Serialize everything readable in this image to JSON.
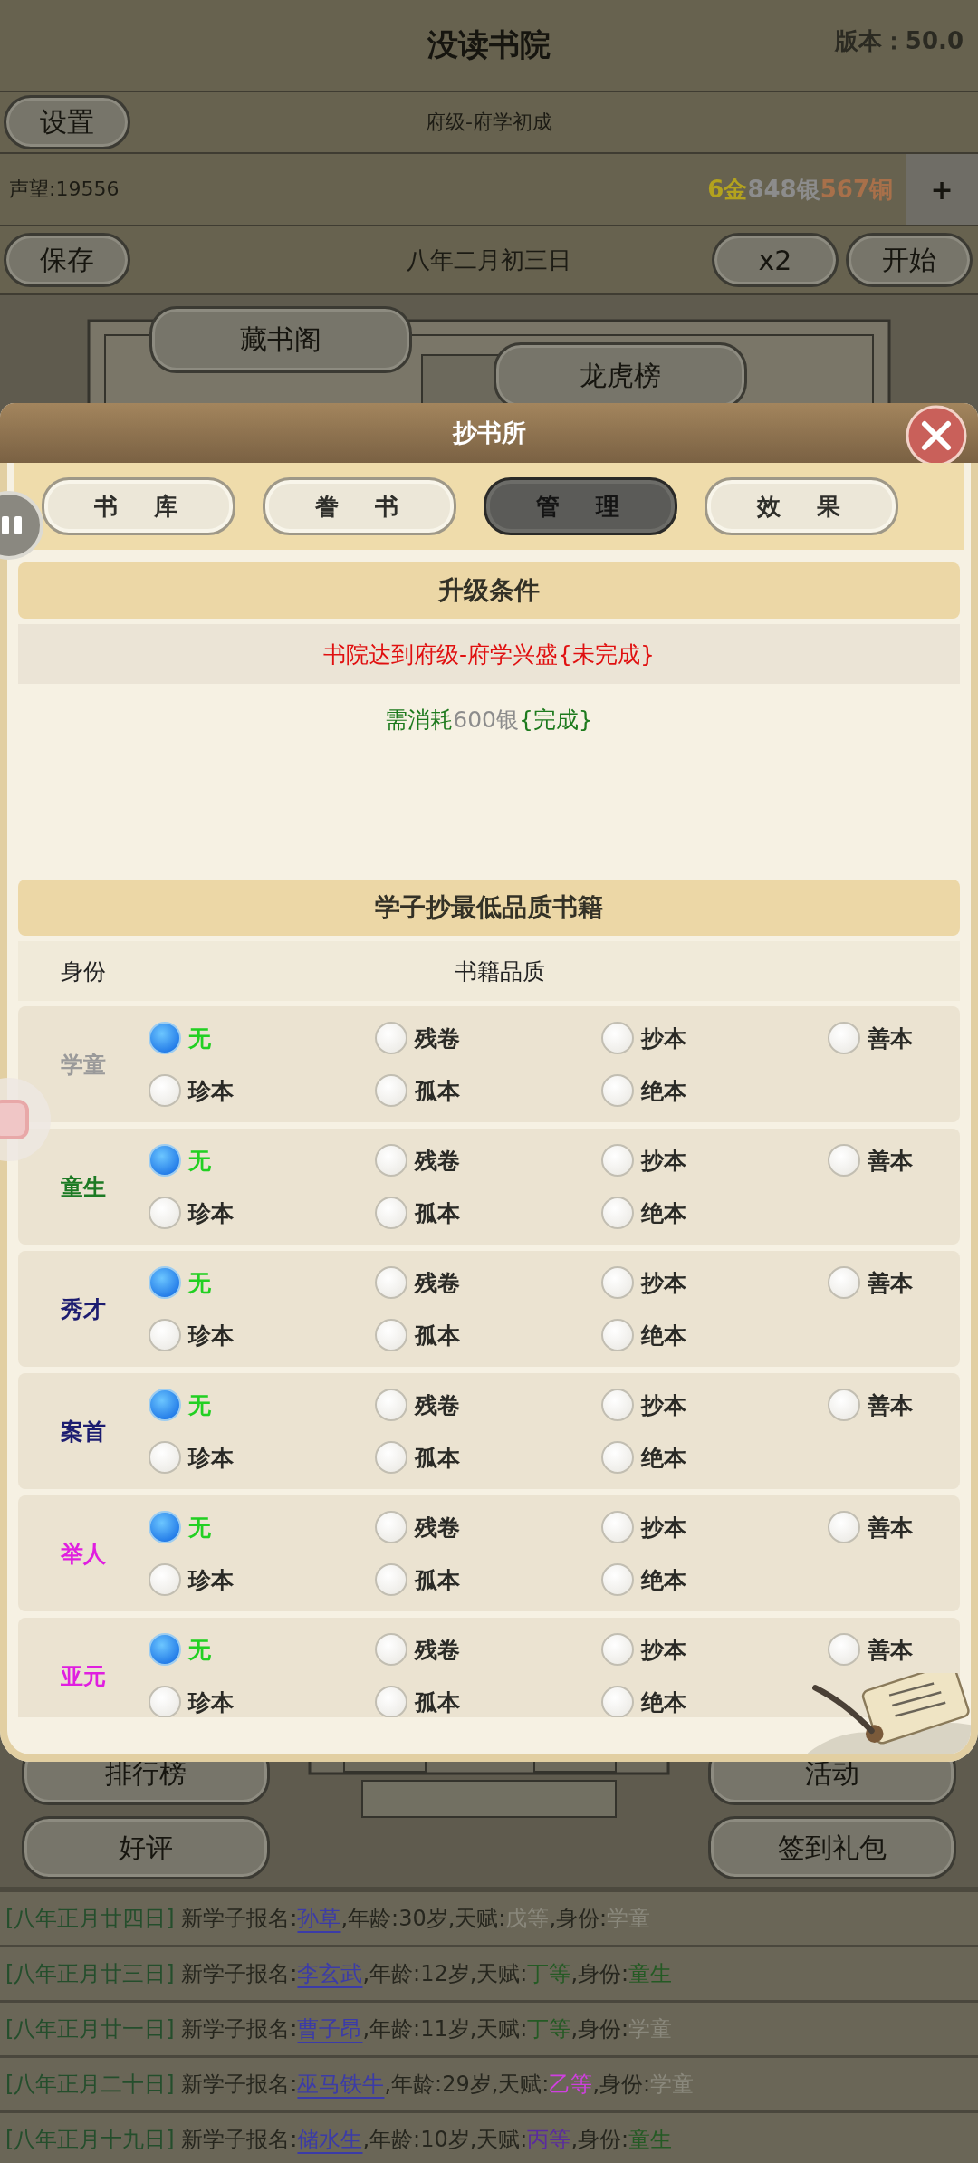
{
  "app_header": {
    "title": "没读书院",
    "version": "版本：50.0"
  },
  "settings_button": "设置",
  "level_label": "府级-府学初成",
  "reputation": "声望:19556",
  "currency": [
    {
      "text": "6金",
      "color": "#b3a21e"
    },
    {
      "text": "848银",
      "color": "#8c8c8c"
    },
    {
      "text": "567铜",
      "color": "#a8704a"
    }
  ],
  "add_button": "+",
  "save_button": "保存",
  "date": "八年二月初三日",
  "speed_button": "x2",
  "start_button": "开始",
  "scene_buttons_top": [
    "藏书阁",
    "龙虎榜"
  ],
  "scene_buttons_bottom": [
    "排行榜",
    "活动",
    "好评",
    "签到礼包"
  ],
  "dialog": {
    "title": "抄书所",
    "tabs": [
      {
        "label": "书库",
        "selected": false
      },
      {
        "label": "誊书",
        "selected": false
      },
      {
        "label": "管理",
        "selected": true
      },
      {
        "label": "效果",
        "selected": false
      }
    ],
    "upgrade": {
      "title": "升级条件",
      "conditions": [
        {
          "text": "书院达到府级-府学兴盛{未完成}",
          "done": false
        },
        {
          "text": "需消耗**600银**{完成}",
          "done": true
        }
      ]
    },
    "quality": {
      "title": "学子抄最低品质书籍",
      "columns": [
        "身份",
        "书籍品质"
      ],
      "ranks": [
        {
          "name": "学童",
          "color": "#9a9a9a",
          "options": [
            {
              "label": "无",
              "selected": true
            },
            {
              "label": "残卷",
              "selected": false
            },
            {
              "label": "抄本",
              "selected": false
            },
            {
              "label": "善本",
              "selected": false
            },
            {
              "label": "珍本",
              "selected": false
            },
            {
              "label": "孤本",
              "selected": false
            },
            {
              "label": "绝本",
              "selected": false
            }
          ]
        },
        {
          "name": "童生",
          "color": "#1c7a24",
          "options": [
            {
              "label": "无",
              "selected": true
            },
            {
              "label": "残卷",
              "selected": false
            },
            {
              "label": "抄本",
              "selected": false
            },
            {
              "label": "善本",
              "selected": false
            },
            {
              "label": "珍本",
              "selected": false
            },
            {
              "label": "孤本",
              "selected": false
            },
            {
              "label": "绝本",
              "selected": false
            }
          ]
        },
        {
          "name": "秀才",
          "color": "#1c1c70",
          "options": [
            {
              "label": "无",
              "selected": true
            },
            {
              "label": "残卷",
              "selected": false
            },
            {
              "label": "抄本",
              "selected": false
            },
            {
              "label": "善本",
              "selected": false
            },
            {
              "label": "珍本",
              "selected": false
            },
            {
              "label": "孤本",
              "selected": false
            },
            {
              "label": "绝本",
              "selected": false
            }
          ]
        },
        {
          "name": "案首",
          "color": "#1c1c70",
          "options": [
            {
              "label": "无",
              "selected": true
            },
            {
              "label": "残卷",
              "selected": false
            },
            {
              "label": "抄本",
              "selected": false
            },
            {
              "label": "善本",
              "selected": false
            },
            {
              "label": "珍本",
              "selected": false
            },
            {
              "label": "孤本",
              "selected": false
            },
            {
              "label": "绝本",
              "selected": false
            }
          ]
        },
        {
          "name": "举人",
          "color": "#e01ee0",
          "options": [
            {
              "label": "无",
              "selected": true
            },
            {
              "label": "残卷",
              "selected": false
            },
            {
              "label": "抄本",
              "selected": false
            },
            {
              "label": "善本",
              "selected": false
            },
            {
              "label": "珍本",
              "selected": false
            },
            {
              "label": "孤本",
              "selected": false
            },
            {
              "label": "绝本",
              "selected": false
            }
          ]
        },
        {
          "name": "亚元",
          "color": "#e01ee0",
          "options": [
            {
              "label": "无",
              "selected": true
            },
            {
              "label": "残卷",
              "selected": false
            },
            {
              "label": "抄本",
              "selected": false
            },
            {
              "label": "善本",
              "selected": false
            },
            {
              "label": "珍本",
              "selected": false
            },
            {
              "label": "孤本",
              "selected": false
            },
            {
              "label": "绝本",
              "selected": false
            }
          ]
        }
      ]
    }
  },
  "logs": [
    {
      "segments": [
        {
          "text": "[八年正月廿四日] ",
          "color": "#244e2c"
        },
        {
          "text": "新学子报名:",
          "color": "#26261e"
        },
        {
          "text": "孙草",
          "color": "#3b3ba8",
          "kind": "link"
        },
        {
          "text": ",年龄:30岁,天赋:",
          "color": "#26261e"
        },
        {
          "text": "戊等",
          "color": "#8a887c"
        },
        {
          "text": ",身份:",
          "color": "#26261e"
        },
        {
          "text": "学童",
          "color": "#8a887c"
        }
      ]
    },
    {
      "segments": [
        {
          "text": "[八年正月廿三日] ",
          "color": "#244e2c"
        },
        {
          "text": "新学子报名:",
          "color": "#26261e"
        },
        {
          "text": "李玄武",
          "color": "#3b3ba8",
          "kind": "link"
        },
        {
          "text": ",年龄:12岁,天赋:",
          "color": "#26261e"
        },
        {
          "text": "丁等",
          "color": "#245a24"
        },
        {
          "text": ",身份:",
          "color": "#26261e"
        },
        {
          "text": "童生",
          "color": "#245a24"
        }
      ]
    },
    {
      "segments": [
        {
          "text": "[八年正月廿一日] ",
          "color": "#244e2c"
        },
        {
          "text": "新学子报名:",
          "color": "#26261e"
        },
        {
          "text": "曹子昂",
          "color": "#3b3ba8",
          "kind": "link"
        },
        {
          "text": ",年龄:11岁,天赋:",
          "color": "#26261e"
        },
        {
          "text": "丁等",
          "color": "#245a24"
        },
        {
          "text": ",身份:",
          "color": "#26261e"
        },
        {
          "text": "学童",
          "color": "#8a887c"
        }
      ]
    },
    {
      "segments": [
        {
          "text": "[八年正月二十日] ",
          "color": "#244e2c"
        },
        {
          "text": "新学子报名:",
          "color": "#26261e"
        },
        {
          "text": "巫马铁牛",
          "color": "#3b3ba8",
          "kind": "link"
        },
        {
          "text": ",年龄:29岁,天赋:",
          "color": "#26261e"
        },
        {
          "text": "乙等",
          "color": "#d040e0"
        },
        {
          "text": ",身份:",
          "color": "#26261e"
        },
        {
          "text": "学童",
          "color": "#8a887c"
        }
      ]
    },
    {
      "segments": [
        {
          "text": "[八年正月十九日] ",
          "color": "#244e2c"
        },
        {
          "text": "新学子报名:",
          "color": "#26261e"
        },
        {
          "text": "储水生",
          "color": "#3b3ba8",
          "kind": "link"
        },
        {
          "text": ",年龄:10岁,天赋:",
          "color": "#26261e"
        },
        {
          "text": "丙等",
          "color": "#5a2aa0"
        },
        {
          "text": ",身份:",
          "color": "#26261e"
        },
        {
          "text": "童生",
          "color": "#245a24"
        }
      ]
    }
  ]
}
